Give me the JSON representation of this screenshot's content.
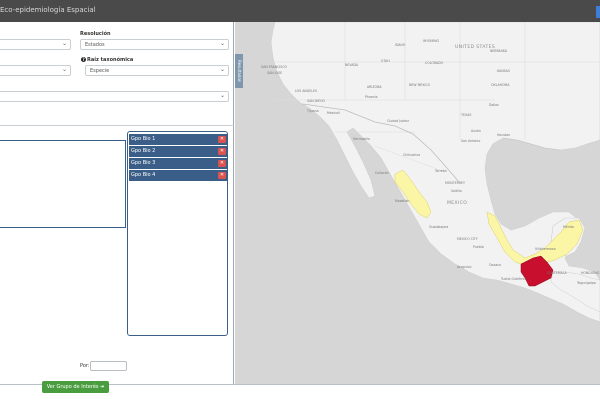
{
  "header": {
    "title": "Eco-epidemiología Espacial"
  },
  "form": {
    "resolucion_label": "Resolución",
    "resolucion_value": "Estados",
    "raiz_label": "Raíz taxonómica",
    "raiz_value": "Especie",
    "grupos": [
      "Gpo Bio 1",
      "Gpo Bio 2",
      "Gpo Bio 3",
      "Gpo Bio 4"
    ],
    "por_label": "Por:",
    "ver_button": "Ver Grupo de Interés ➔"
  },
  "map": {
    "tab_label": "Resultados",
    "colors": {
      "water": "#d6d6d6",
      "land": "#f2f2f2",
      "yellow": "#fbf6a6",
      "red": "#c8102e"
    },
    "country_labels": [
      "UNITED STATES",
      "MEXICO",
      "GUATEMALA"
    ],
    "city_labels": [
      "IDAHO",
      "WYOMING",
      "NEBRASKA",
      "NEVADA",
      "UTAH",
      "KANSAS",
      "COLORADO",
      "SAN FRANCISCO",
      "SAN JOSE",
      "OKLAHOMA",
      "ARIZONA",
      "NEW MEXICO",
      "LOS ANGELES",
      "SAN DIEGO",
      "Phoenix",
      "Dallas",
      "TEXAS",
      "Austin",
      "San Antonio",
      "Houston",
      "Tijuana",
      "Mexicali",
      "Hermosillo",
      "Chihuahua",
      "Ciudad Juárez",
      "Torreón",
      "Culiacán",
      "MONTERREY",
      "Saltillo",
      "Mazatlán",
      "Guadalajara",
      "MEXICO CITY",
      "Puebla",
      "Acapulco",
      "Oaxaca",
      "Villahermosa",
      "Mérida",
      "Tuxtla Gutiérrez",
      "HONDURAS",
      "Tegucigalpa"
    ]
  }
}
